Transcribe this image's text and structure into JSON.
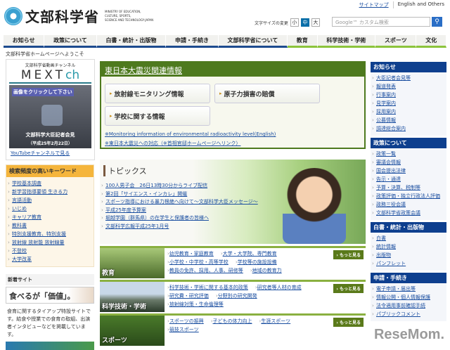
{
  "header": {
    "top_links": [
      "サイトマップ",
      "English and Others"
    ],
    "logo_text": "文部科学省",
    "logo_en": [
      "MINISTRY OF EDUCATION,",
      "CULTURE, SPORTS,",
      "SCIENCE AND TECHNOLOGY-JAPAN"
    ],
    "font_size_label": "文字サイズの変更",
    "font_sizes": [
      "小",
      "中",
      "大"
    ],
    "search_placeholder": "Google™ カスタム検索"
  },
  "nav": [
    "お知らせ",
    "政策について",
    "白書・統計・出版物",
    "申請・手続き",
    "文部科学省について",
    "教育",
    "科学技術・学術",
    "スポーツ",
    "文化"
  ],
  "welcome": "文部科学省ホームページへようこそ",
  "mext": {
    "sub": "文部科学省動画チャンネル",
    "title": "MEXT",
    "title_ch": "ch",
    "click": "画像をクリックして下さい",
    "caption": "文部科学大臣記者会見",
    "date": "（平成25年2月22日）",
    "youtube": "YouTubeチャンネルで見る"
  },
  "keywords": {
    "title": "検索頻度の高いキーワード",
    "items": [
      "学校基本調査",
      "新学習指導要領 生きる力",
      "言語活動",
      "いじめ",
      "キャリア教育",
      "教科書",
      "特別支援教育、特別支援",
      "放射線 放射能 放射線量",
      "不登校",
      "大学改革"
    ]
  },
  "new_sites": {
    "title": "新着サイト",
    "banner": "食べるが「価値」。",
    "text": "食育に関するタイアップ特設サイトです。給食や授業での食育の取組、出演者インタビューなどを掲載しています。"
  },
  "quake": {
    "title": "東日本大震災関連情報",
    "buttons": [
      "放射線モニタリング情報",
      "原子力損害の賠償",
      "学校に関する情報"
    ],
    "links": [
      "※Monitoring information of environmental radioactivity level(English)",
      "※東日本大震災への対応（※首相官邸ホームページへリンク）"
    ]
  },
  "topics": {
    "title": "トピックス",
    "items": [
      "100人男子会　26日13時30分からライブ配信",
      "第2回「サイエンス・インカレ」開催",
      "スポーツ指導における暴力根絶へ向けて～文部科学大臣メッセージ～",
      "平成25年度予算案",
      "堀越学園（群馬県）の在学生と保護者の皆様へ",
      "文部科学広報平成25年1月号"
    ]
  },
  "categories": [
    {
      "name": "教育",
      "links": [
        "幼児教育・家庭教育",
        "大学・大学院、専門教育",
        "小学校・中学校・高等学校",
        "学校等の施設設備",
        "教員の免許、採用、人事、研修等",
        "地域の教育力"
      ],
      "more": "もっと見る"
    },
    {
      "name": "科学技術・学術",
      "links": [
        "科学技術・学術に関する基本的政策",
        "研究者等人材の育成",
        "研究費・研究評価",
        "分野別の研究開発",
        "放射線対策・生命倫理等"
      ],
      "more": "もっと見る"
    },
    {
      "name": "スポーツ",
      "links": [
        "スポーツの振興",
        "子どもの体力向上",
        "生涯スポーツ",
        "競技スポーツ"
      ],
      "more": "もっと見る"
    }
  ],
  "right": [
    {
      "title": "お知らせ",
      "items": [
        "大臣記者会見等",
        "報道発表",
        "行事案内",
        "見学案内",
        "採用案内",
        "公募情報",
        "調達総合案内"
      ]
    },
    {
      "title": "政策について",
      "items": [
        "政策一覧",
        "審議会情報",
        "国会提出法律",
        "告示・通達",
        "予算・決算、税制等",
        "政策評価・独立行政法人評価",
        "政務三役会議",
        "文部科学省政策会議"
      ]
    },
    {
      "title": "白書・統計・出版物",
      "items": [
        "白書",
        "統計情報",
        "出版物",
        "パンフレット"
      ]
    },
    {
      "title": "申請・手続き",
      "items": [
        "電子申請・届出等",
        "情報公開・個人情報保護",
        "法令適用事前確認手続",
        "パブリックコメント"
      ]
    }
  ],
  "watermark": "ReseMom."
}
